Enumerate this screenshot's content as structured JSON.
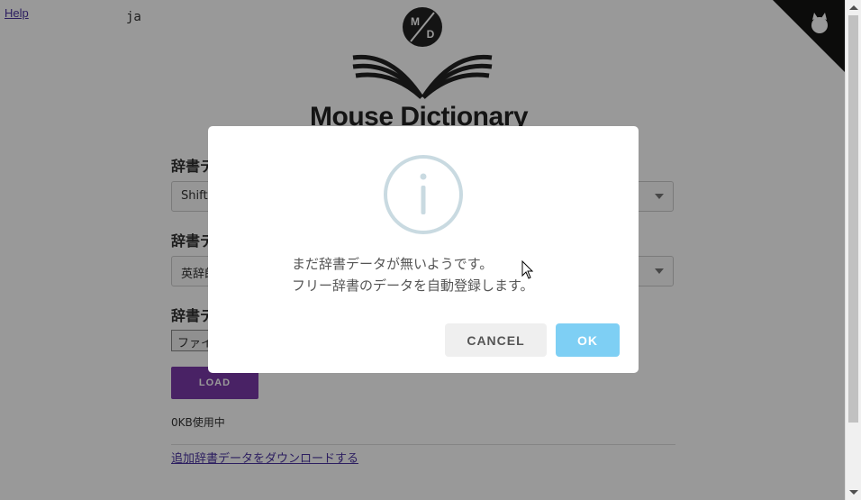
{
  "header": {
    "help_label": "Help",
    "language": "ja"
  },
  "logo": {
    "title": "Mouse Dictionary",
    "badge_top": "M",
    "badge_bottom": "D"
  },
  "form": {
    "label_1": "辞書デ",
    "select_1": "Shift-",
    "label_2": "辞書デ",
    "select_2": "英辞郎",
    "label_3": "辞書デ",
    "file_button": "ファイ",
    "load_button": "LOAD",
    "usage": "0KB使用中",
    "download_link": "追加辞書データをダウンロードする"
  },
  "dialog": {
    "message_line1": "まだ辞書データが無いようです。",
    "message_line2": "フリー辞書のデータを自動登録します。",
    "cancel_label": "CANCEL",
    "ok_label": "OK",
    "icon": "info-icon"
  },
  "colors": {
    "overlay": "#000000",
    "ok_button": "#7ecff4",
    "load_button": "#7b3aa8",
    "link": "#4a32a0",
    "info_icon": "#c9dae1"
  }
}
